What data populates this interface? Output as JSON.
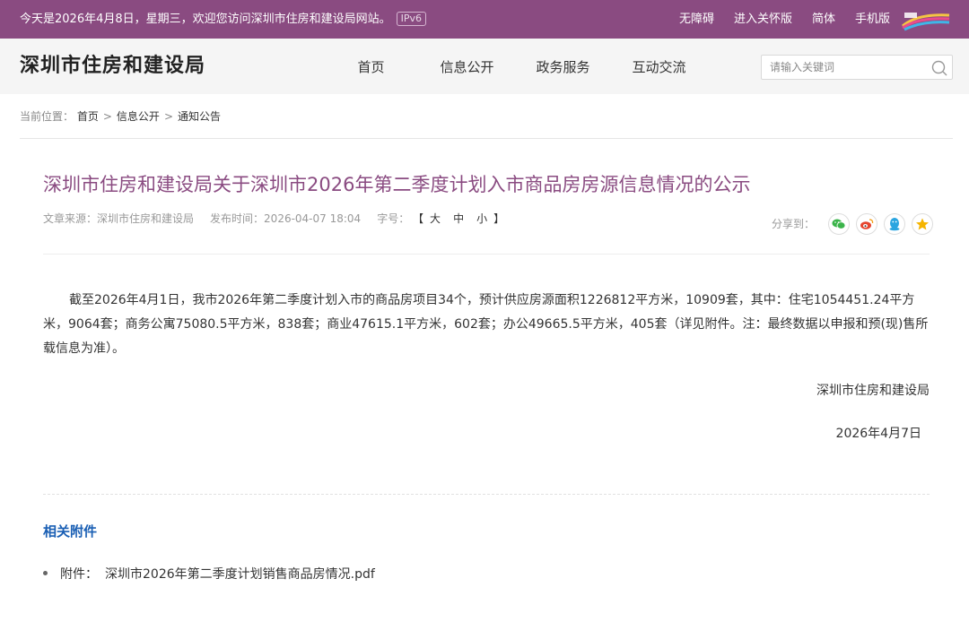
{
  "topbar": {
    "welcome": "今天是2026年4月8日，星期三，欢迎您访问深圳市住房和建设局网站。",
    "ipv6": "IPv6",
    "links": [
      "无障碍",
      "进入关怀版",
      "简体",
      "手机版"
    ]
  },
  "header": {
    "site_title": "深圳市住房和建设局",
    "nav": [
      "首页",
      "信息公开",
      "政务服务",
      "互动交流"
    ],
    "search_placeholder": "请输入关键词"
  },
  "breadcrumb": {
    "label": "当前位置：",
    "items": [
      "首页",
      "信息公开",
      "通知公告"
    ],
    "separator": ">"
  },
  "article": {
    "title": "深圳市住房和建设局关于深圳市2026年第二季度计划入市商品房房源信息情况的公示",
    "source_label": "文章来源：",
    "source": "深圳市住房和建设局",
    "time_label": "发布时间：",
    "time": "2026-04-07 18:04",
    "fontsize_label": "字号：",
    "fontsize_open": "【",
    "fontsize_options": [
      "大",
      "中",
      "小"
    ],
    "fontsize_close": "】",
    "share_label": "分享到：",
    "share_icons": [
      "wechat-icon",
      "weibo-icon",
      "qq-icon",
      "qzone-icon"
    ],
    "body": "截至2026年4月1日，我市2026年第二季度计划入市的商品房项目34个，预计供应房源面积1226812平方米，10909套，其中：住宅1054451.24平方米，9064套；商务公寓75080.5平方米，838套；商业47615.1平方米，602套；办公49665.5平方米，405套（详见附件。注：最终数据以申报和预(现)售所载信息为准）。",
    "signature_org": "深圳市住房和建设局",
    "signature_date": "2026年4月7日"
  },
  "attachments": {
    "title": "相关附件",
    "label": "附件：",
    "items": [
      "深圳市2026年第二季度计划销售商品房情况.pdf"
    ]
  },
  "colors": {
    "brand": "#8a4b81",
    "attachment_title": "#1a5fb4",
    "wechat": "#3bb44a",
    "weibo": "#e6452e",
    "qq": "#2aa5e0",
    "qzone": "#f5b400"
  }
}
